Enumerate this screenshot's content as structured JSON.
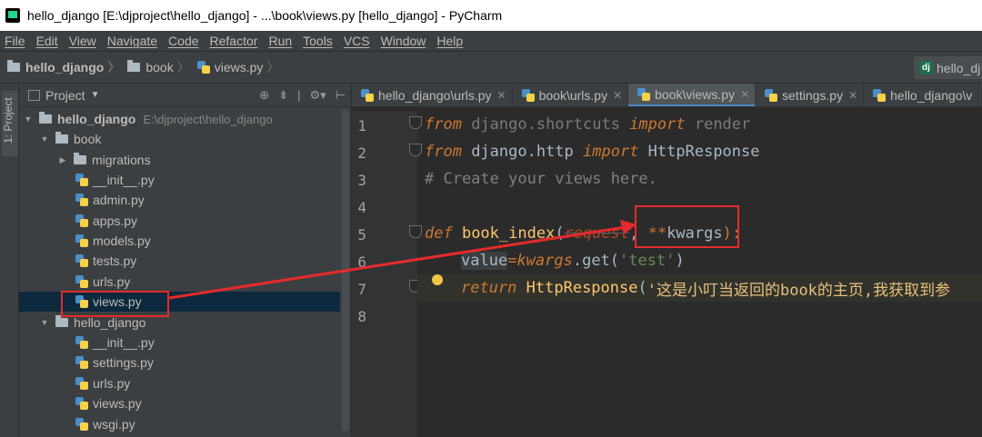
{
  "window": {
    "title": "hello_django [E:\\djproject\\hello_django] - ...\\book\\views.py [hello_django] - PyCharm"
  },
  "menu": [
    "File",
    "Edit",
    "View",
    "Navigate",
    "Code",
    "Refactor",
    "Run",
    "Tools",
    "VCS",
    "Window",
    "Help"
  ],
  "breadcrumb": {
    "project": "hello_django",
    "folder": "book",
    "file": "views.py",
    "run_config": "hello_dj"
  },
  "toolstrip": {
    "label": "1: Project"
  },
  "project_panel": {
    "title": "Project",
    "tree": [
      {
        "label": "hello_django",
        "path": "E:\\djproject\\hello_django",
        "kind": "root-folder",
        "expanded": true
      },
      {
        "label": "book",
        "kind": "folder",
        "expanded": true
      },
      {
        "label": "migrations",
        "kind": "folder",
        "expanded": false
      },
      {
        "label": "__init__.py",
        "kind": "py"
      },
      {
        "label": "admin.py",
        "kind": "py"
      },
      {
        "label": "apps.py",
        "kind": "py"
      },
      {
        "label": "models.py",
        "kind": "py"
      },
      {
        "label": "tests.py",
        "kind": "py"
      },
      {
        "label": "urls.py",
        "kind": "py"
      },
      {
        "label": "views.py",
        "kind": "py",
        "selected": true
      },
      {
        "label": "hello_django",
        "kind": "folder",
        "expanded": true
      },
      {
        "label": "__init__.py",
        "kind": "py"
      },
      {
        "label": "settings.py",
        "kind": "py"
      },
      {
        "label": "urls.py",
        "kind": "py"
      },
      {
        "label": "views.py",
        "kind": "py"
      },
      {
        "label": "wsgi.py",
        "kind": "py"
      }
    ]
  },
  "tabs": [
    {
      "label": "hello_django\\urls.py",
      "active": false
    },
    {
      "label": "book\\urls.py",
      "active": false
    },
    {
      "label": "book\\views.py",
      "active": true
    },
    {
      "label": "settings.py",
      "active": false
    },
    {
      "label": "hello_django\\v",
      "active": false
    }
  ],
  "editor": {
    "line_numbers": [
      "1",
      "2",
      "3",
      "4",
      "5",
      "6",
      "7",
      "8"
    ],
    "line1": {
      "kw1": "from",
      "mod": " django.shortcuts ",
      "kw2": "import",
      "name": " render"
    },
    "line2": {
      "kw1": "from",
      "mod": " django.http ",
      "kw2": "import",
      "name": " HttpResponse"
    },
    "line3": {
      "comment": "# Create your views here."
    },
    "line5": {
      "kw": "def",
      "fn": " book_index",
      "open": "(",
      "param": "request",
      "comma": ", ",
      "stars": "**",
      "kwargs": "kwargs",
      "close": "):"
    },
    "line6": {
      "var": "value",
      "eq": "=",
      "kwargs": "kwargs",
      "call": ".get(",
      "str": "'test'",
      "close": ")"
    },
    "line7": {
      "kw": "return",
      "cls": " HttpResponse",
      "open": "(",
      "str": "'这是小叮当返回的book的主页,我获取到参"
    }
  },
  "colors": {
    "annotation": "#e52b2b",
    "editor_bg": "#2b2b2b",
    "panel_bg": "#3c3f41",
    "keyword": "#cc7832",
    "selection": "#0d293e"
  }
}
